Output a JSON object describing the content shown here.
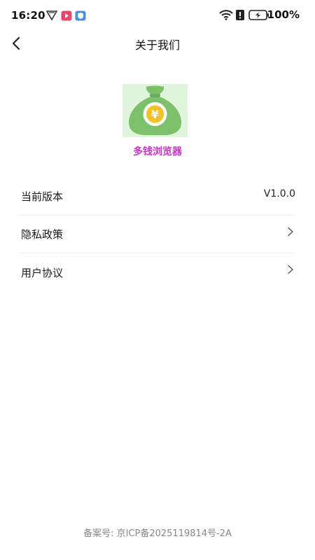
{
  "status_bar": {
    "time": "16:20",
    "battery": "100%",
    "icons": [
      "vpn-icon",
      "video-app-icon",
      "shield-app-icon",
      "wifi-icon",
      "alert-icon",
      "battery-icon"
    ]
  },
  "nav": {
    "title": "关于我们",
    "back_icon": "chevron-left-icon"
  },
  "app": {
    "name": "多钱浏览器",
    "logo_icon": "money-bag-icon",
    "logo_symbol": "¥"
  },
  "list": {
    "items": [
      {
        "label": "当前版本",
        "value": "V1.0.0"
      },
      {
        "label": "隐私政策",
        "icon": "chevron-right-icon"
      },
      {
        "label": "用户协议",
        "icon": "chevron-right-icon"
      }
    ]
  },
  "footer": {
    "text": "备案号: 京ICP备2025119814号-2A"
  },
  "colors": {
    "accent": "#cc33cc",
    "logo_bg": "#dff5dc",
    "logo_bag": "#7cc16a",
    "yen_circle": "#f5c11a"
  }
}
